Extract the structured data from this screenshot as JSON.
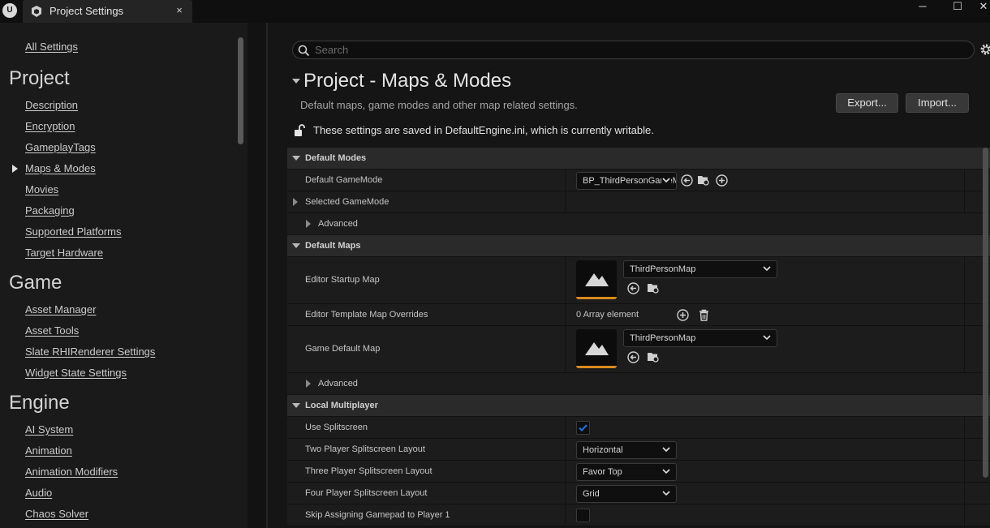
{
  "window": {
    "logo": "U",
    "tab_title": "Project Settings",
    "tab_close": "×",
    "minimize": "─",
    "maximize": "☐",
    "close": "✕"
  },
  "nav": {
    "all_settings": "All Settings",
    "project_title": "Project",
    "project_items": [
      "Description",
      "Encryption",
      "GameplayTags",
      "Maps & Modes",
      "Movies",
      "Packaging",
      "Supported Platforms",
      "Target Hardware"
    ],
    "game_title": "Game",
    "game_items": [
      "Asset Manager",
      "Asset Tools",
      "Slate RHIRenderer Settings",
      "Widget State Settings"
    ],
    "engine_title": "Engine",
    "engine_items": [
      "AI System",
      "Animation",
      "Animation Modifiers",
      "Audio",
      "Chaos Solver"
    ],
    "selected": "Maps & Modes"
  },
  "search": {
    "placeholder": "Search"
  },
  "header": {
    "title": "Project - Maps & Modes",
    "subtitle": "Default maps, game modes and other map related settings.",
    "export_label": "Export...",
    "import_label": "Import...",
    "notice": "These settings are saved in DefaultEngine.ini, which is currently writable."
  },
  "sections": {
    "default_modes": {
      "title": "Default Modes",
      "default_gamemode_label": "Default GameMode",
      "default_gamemode_value": "BP_ThirdPersonGameMode",
      "selected_gamemode_label": "Selected GameMode",
      "advanced_label": "Advanced"
    },
    "default_maps": {
      "title": "Default Maps",
      "editor_startup_label": "Editor Startup Map",
      "editor_startup_value": "ThirdPersonMap",
      "template_overrides_label": "Editor Template Map Overrides",
      "template_overrides_value": "0 Array element",
      "game_default_label": "Game Default Map",
      "game_default_value": "ThirdPersonMap",
      "advanced_label": "Advanced"
    },
    "local_multiplayer": {
      "title": "Local Multiplayer",
      "use_splitscreen_label": "Use Splitscreen",
      "use_splitscreen_checked": true,
      "two_player_label": "Two Player Splitscreen Layout",
      "two_player_value": "Horizontal",
      "three_player_label": "Three Player Splitscreen Layout",
      "three_player_value": "Favor Top",
      "four_player_label": "Four Player Splitscreen Layout",
      "four_player_value": "Grid",
      "skip_gamepad_label": "Skip Assigning Gamepad to Player 1",
      "skip_gamepad_checked": false
    }
  },
  "colors": {
    "accent": "#d98a1c",
    "check": "#1f6fd6",
    "background": "#151515"
  }
}
